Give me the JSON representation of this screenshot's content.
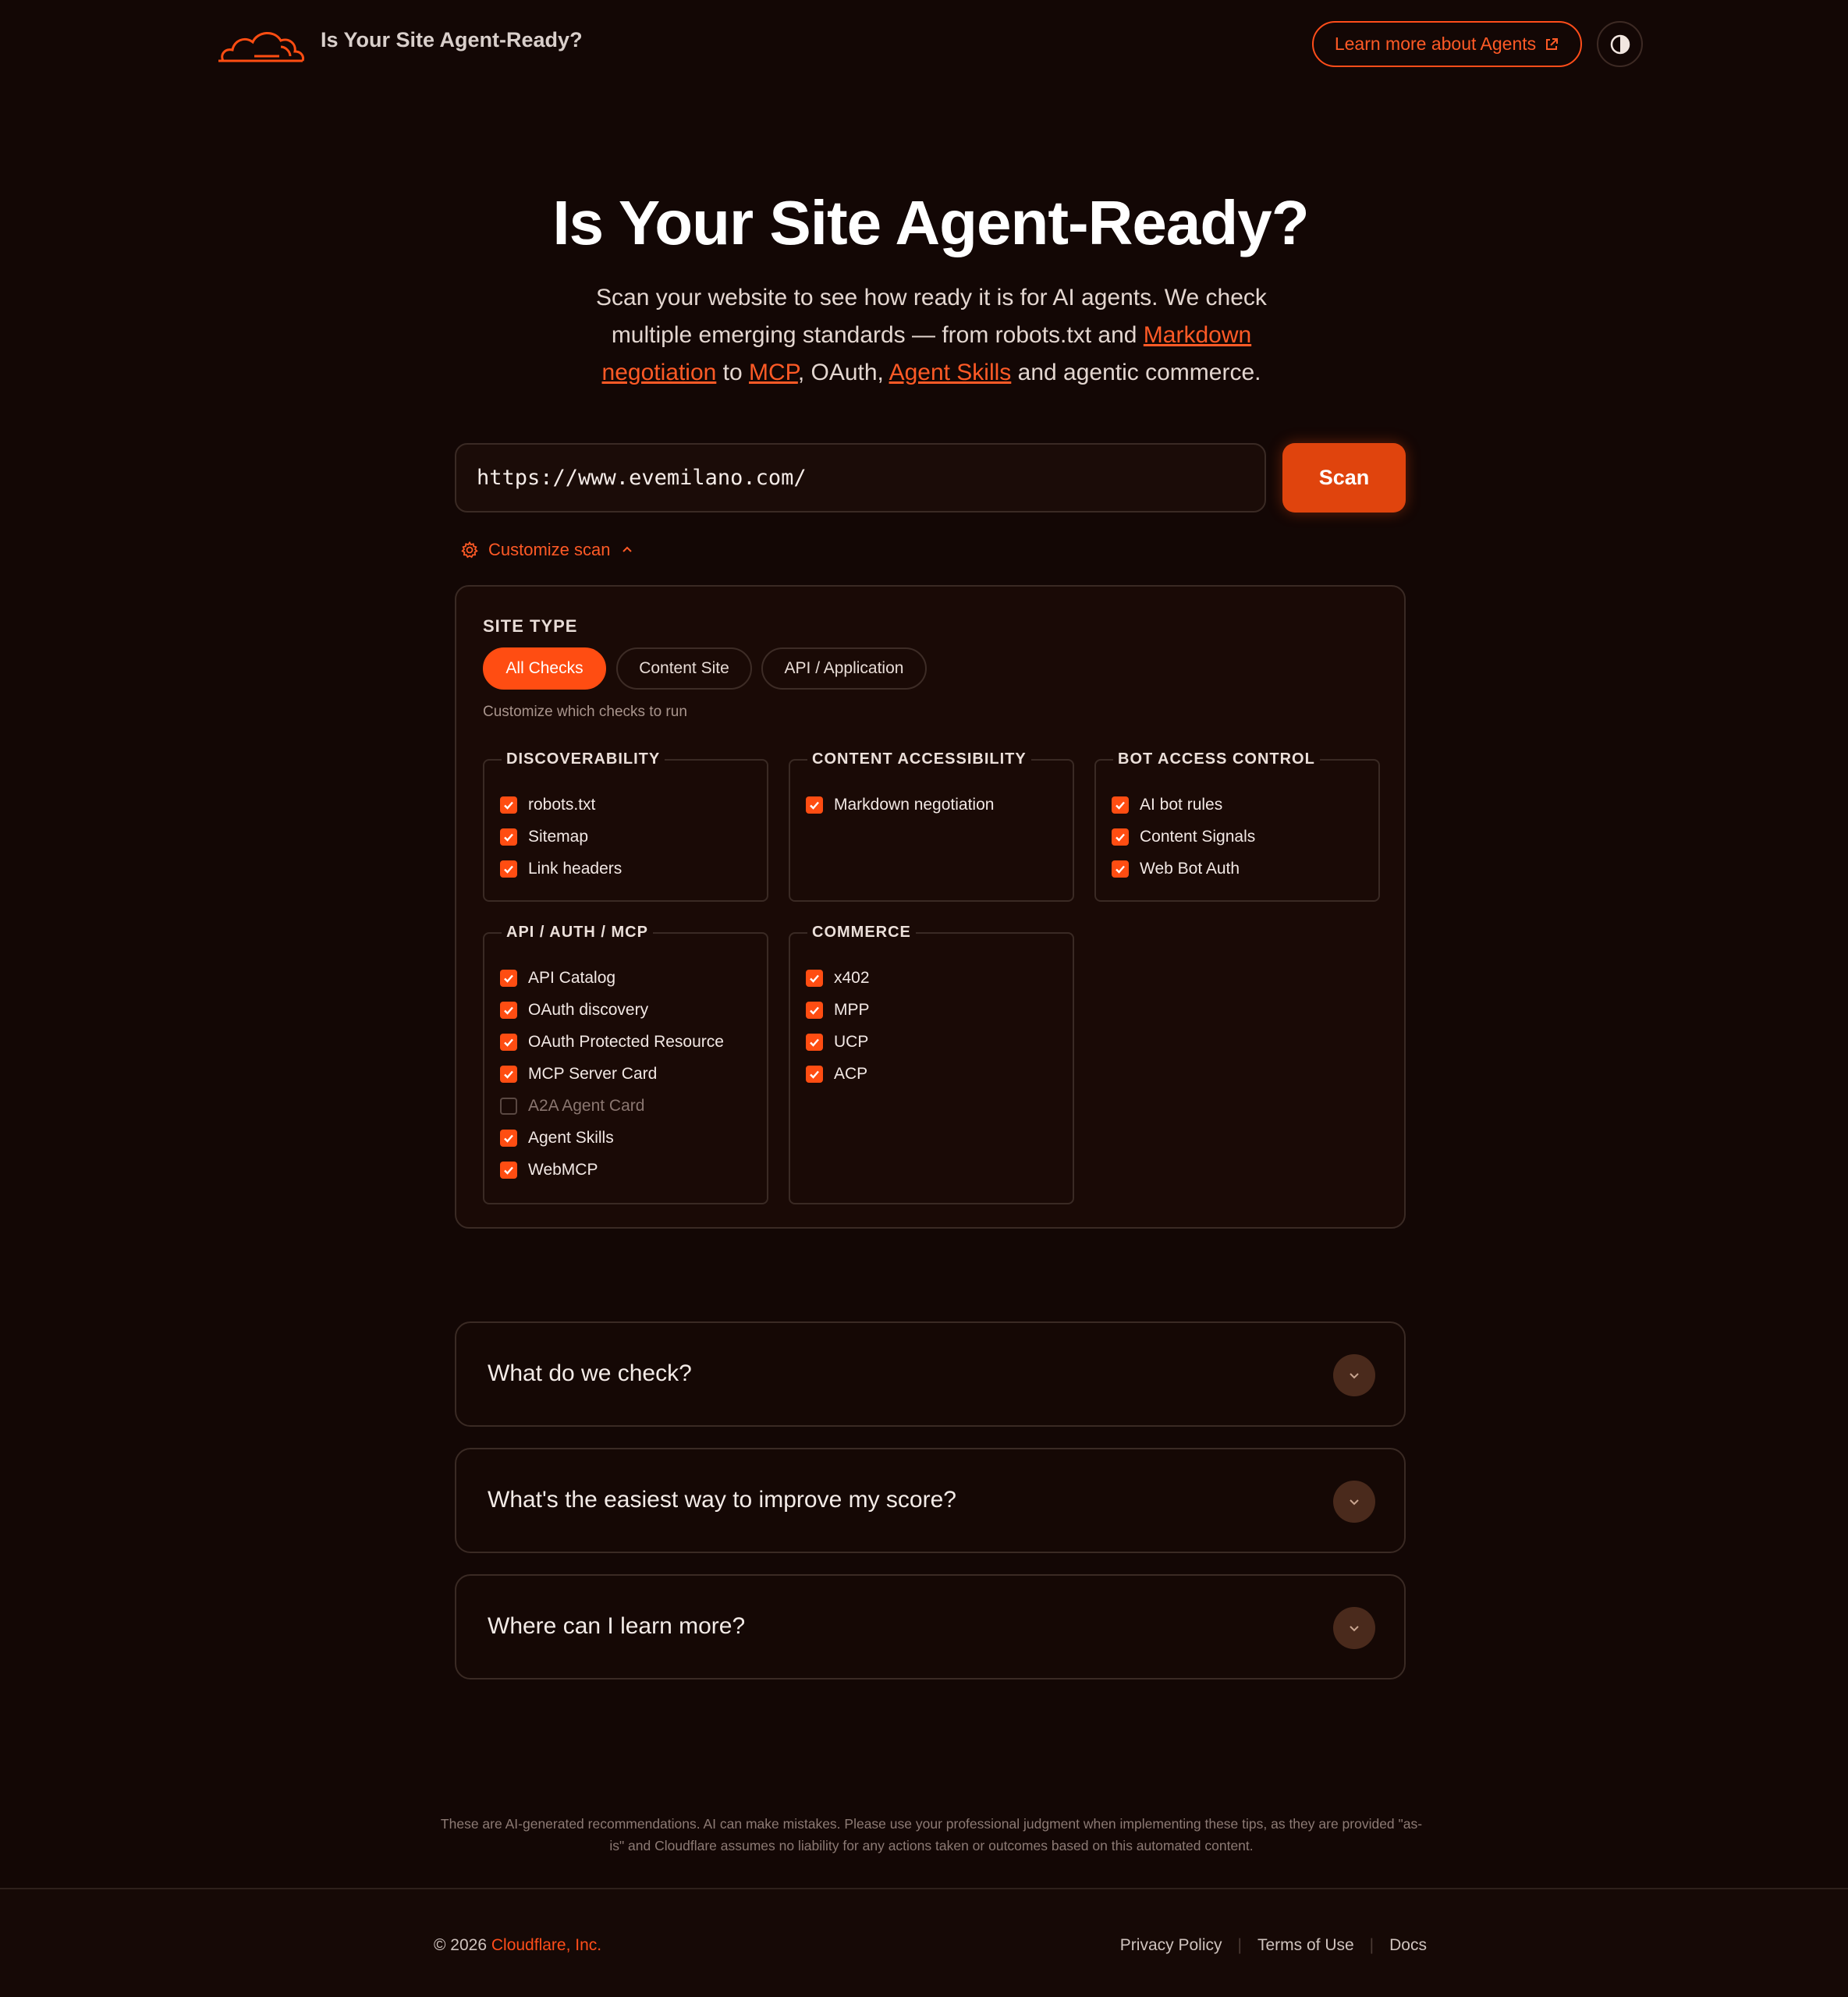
{
  "header": {
    "title": "Is Your Site Agent-Ready?",
    "learn_more": "Learn more about Agents",
    "theme_toggle_icon": "contrast-icon",
    "logo_icon": "cloud-icon"
  },
  "hero": {
    "title": "Is Your Site Agent-Ready?",
    "sub_1": "Scan your website to see how ready it is for AI agents. We check multiple emerging standards — from robots.txt and ",
    "link_markdown": "Markdown negotiation",
    "sub_2": " to ",
    "link_mcp": "MCP",
    "sub_3": ", OAuth, ",
    "link_skills": "Agent Skills",
    "sub_4": " and agentic commerce."
  },
  "scan": {
    "url_value": "https://www.evemilano.com/",
    "button": "Scan",
    "customize_label": "Customize scan"
  },
  "panel": {
    "site_type_label": "SITE TYPE",
    "pills": [
      "All Checks",
      "Content Site",
      "API / Application"
    ],
    "active_pill": "All Checks",
    "hint": "Customize which checks to run",
    "groups": {
      "discoverability": {
        "title": "DISCOVERABILITY",
        "items": [
          {
            "label": "robots.txt",
            "checked": true
          },
          {
            "label": "Sitemap",
            "checked": true
          },
          {
            "label": "Link headers",
            "checked": true
          }
        ]
      },
      "content": {
        "title": "CONTENT ACCESSIBILITY",
        "items": [
          {
            "label": "Markdown negotiation",
            "checked": true
          }
        ]
      },
      "bot": {
        "title": "BOT ACCESS CONTROL",
        "items": [
          {
            "label": "AI bot rules",
            "checked": true
          },
          {
            "label": "Content Signals",
            "checked": true
          },
          {
            "label": "Web Bot Auth",
            "checked": true
          }
        ]
      },
      "api": {
        "title": "API / AUTH / MCP",
        "items": [
          {
            "label": "API Catalog",
            "checked": true
          },
          {
            "label": "OAuth discovery",
            "checked": true
          },
          {
            "label": "OAuth Protected Resource",
            "checked": true
          },
          {
            "label": "MCP Server Card",
            "checked": true
          },
          {
            "label": "A2A Agent Card",
            "checked": false
          },
          {
            "label": "Agent Skills",
            "checked": true
          },
          {
            "label": "WebMCP",
            "checked": true
          }
        ]
      },
      "commerce": {
        "title": "COMMERCE",
        "items": [
          {
            "label": "x402",
            "checked": true
          },
          {
            "label": "MPP",
            "checked": true
          },
          {
            "label": "UCP",
            "checked": true
          },
          {
            "label": "ACP",
            "checked": true
          }
        ]
      }
    }
  },
  "faq": [
    {
      "question": "What do we check?"
    },
    {
      "question": "What's the easiest way to improve my score?"
    },
    {
      "question": "Where can I learn more?"
    }
  ],
  "disclaimer": "These are AI-generated recommendations. AI can make mistakes. Please use your professional judgment when implementing these tips, as they are provided \"as-is\" and Cloudflare assumes no liability for any actions taken or outcomes based on this automated content.",
  "footer": {
    "copyright_prefix": "© 2026 ",
    "company": "Cloudflare, Inc.",
    "links": [
      "Privacy Policy",
      "Terms of Use",
      "Docs"
    ]
  },
  "colors": {
    "accent": "#ff4d12",
    "background": "#130705",
    "border": "#3a2a24"
  }
}
